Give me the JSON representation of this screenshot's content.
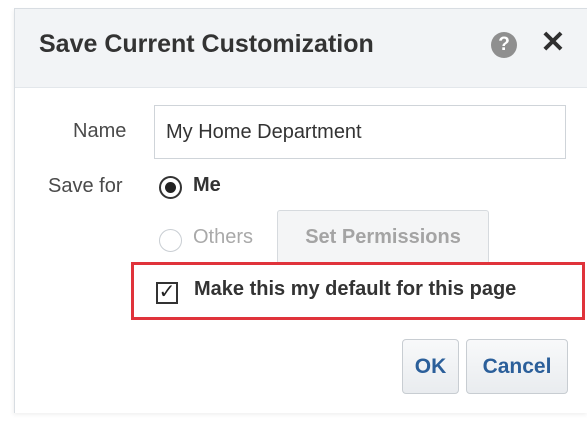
{
  "dialog": {
    "title": "Save Current Customization",
    "help_icon_glyph": "?",
    "close_icon_glyph": "✕"
  },
  "form": {
    "name_label": "Name",
    "name_value": "My Home Department",
    "save_for_label": "Save for",
    "options": {
      "me": "Me",
      "others": "Others"
    },
    "selected_option": "Me",
    "set_permissions_label": "Set Permissions",
    "default_checkbox_label": "Make this my default for this page",
    "default_checkbox_checked": true,
    "checkbox_glyph": "✓"
  },
  "buttons": {
    "ok_label": "OK",
    "cancel_label": "Cancel"
  },
  "colors": {
    "highlight": "#e0333b",
    "button_text": "#2b5f9a"
  }
}
